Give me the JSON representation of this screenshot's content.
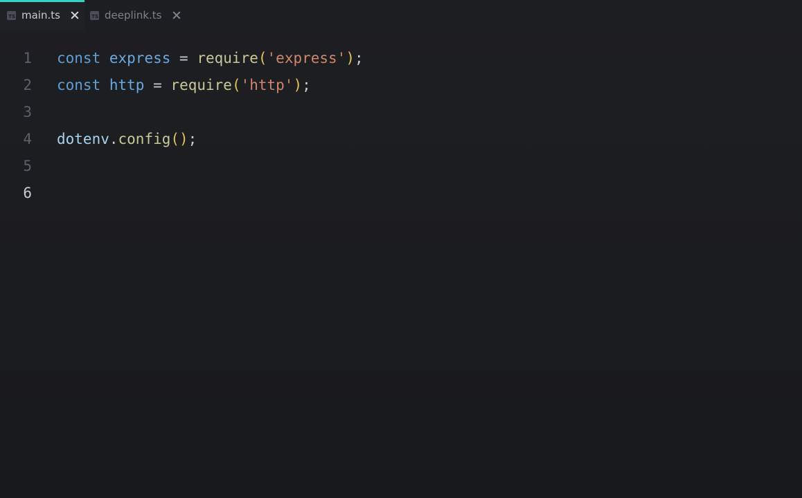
{
  "tabs": [
    {
      "label": "main.ts",
      "icon": "ts-file-icon",
      "active": true
    },
    {
      "label": "deeplink.ts",
      "icon": "ts-file-icon",
      "active": false
    }
  ],
  "ts_icon_text": "TS",
  "colors": {
    "accent": "#2fd4c4",
    "keyword": "#5e9fd6",
    "string": "#d0866a",
    "function": "#c8c89a",
    "paren": "#e2c05c"
  },
  "editor": {
    "current_line": 6,
    "lines": [
      {
        "number": "1",
        "tokens": {
          "kw": "const",
          "var": "express",
          "op": "=",
          "fn": "require",
          "open": "(",
          "str": "'express'",
          "close": ")",
          "end": ";"
        }
      },
      {
        "number": "2",
        "tokens": {
          "kw": "const",
          "var": "http",
          "op": "=",
          "fn": "require",
          "open": "(",
          "str": "'http'",
          "close": ")",
          "end": ";"
        }
      },
      {
        "number": "3",
        "text": ""
      },
      {
        "number": "4",
        "tokens": {
          "obj": "dotenv",
          "dot": ".",
          "method": "config",
          "parens": "()",
          "end": ";"
        }
      },
      {
        "number": "5",
        "text": ""
      },
      {
        "number": "6",
        "text": ""
      }
    ]
  }
}
